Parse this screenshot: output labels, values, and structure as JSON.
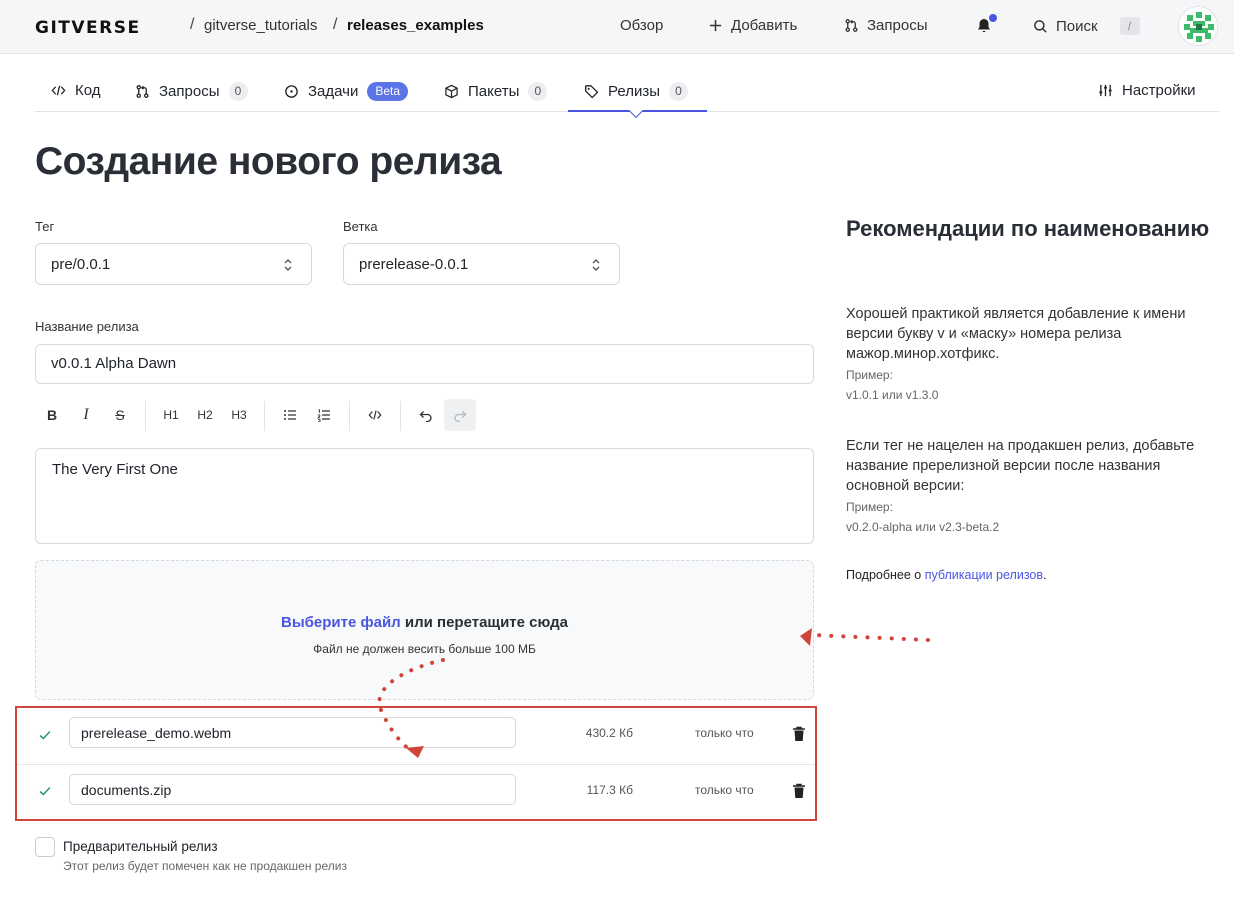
{
  "header": {
    "logo": "GITVERSE",
    "breadcrumb_sep": "/",
    "owner": "gitverse_tutorials",
    "repo": "releases_examples",
    "nav": {
      "overview": "Обзор",
      "add": "Добавить",
      "requests": "Запросы",
      "search": "Поиск",
      "search_shortcut": "/"
    }
  },
  "tabs": [
    {
      "label": "Код",
      "icon": "code-icon"
    },
    {
      "label": "Запросы",
      "icon": "pull-request-icon",
      "count": "0"
    },
    {
      "label": "Задачи",
      "icon": "issue-icon",
      "badge": "Beta"
    },
    {
      "label": "Пакеты",
      "icon": "package-icon",
      "count": "0"
    },
    {
      "label": "Релизы",
      "icon": "tag-icon",
      "count": "0",
      "active": true
    },
    {
      "label": "Настройки",
      "icon": "settings-sliders-icon"
    }
  ],
  "page_title": "Создание нового релиза",
  "form": {
    "tag_label": "Тег",
    "tag_value": "pre/0.0.1",
    "branch_label": "Ветка",
    "branch_value": "prerelease-0.0.1",
    "name_label": "Название релиза",
    "name_value": "v0.0.1 Alpha Dawn",
    "description": "The Very First One",
    "toolbar": {
      "bold": "B",
      "italic": "I",
      "strike": "S",
      "h1": "H1",
      "h2": "H2",
      "h3": "H3"
    },
    "dropzone": {
      "link": "Выберите файл",
      "text": " или перетащите сюда",
      "limit": "Файл не должен весить больше 100 МБ"
    },
    "files": [
      {
        "name": "prerelease_demo.webm",
        "size": "430.2 Кб",
        "time": "только что"
      },
      {
        "name": "documents.zip",
        "size": "117.3 Кб",
        "time": "только что"
      }
    ],
    "prerelease_label": "Предварительный релиз",
    "prerelease_desc": "Этот релиз будет помечен как не продакшен релиз"
  },
  "sidebar": {
    "title": "Рекомендации по наименованию",
    "p1": "Хорошей практикой является добавление к имени версии букву v и «маску» номера релиза мажор.минор.хотфикс.",
    "example_label_1": "Пример:",
    "example_1": "v1.0.1 или v1.3.0",
    "p2": "Если тег не нацелен на продакшен релиз, добавьте название пререлизной версии после названия основной версии:",
    "example_label_2": "Пример:",
    "example_2": "v0.2.0-alpha или v2.3-beta.2",
    "more_prefix": "Подробнее о ",
    "more_link": "публикации релизов",
    "more_suffix": "."
  },
  "colors": {
    "accent": "#4a56e2",
    "annotation": "#d0453a",
    "success": "#2e9e6b"
  }
}
